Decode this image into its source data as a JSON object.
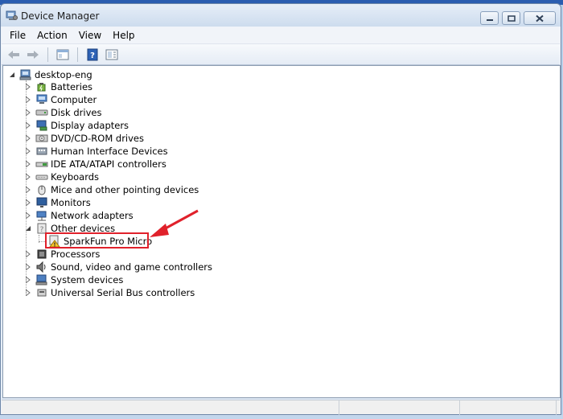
{
  "window": {
    "title": "Device Manager"
  },
  "menu": [
    "File",
    "Action",
    "View",
    "Help"
  ],
  "toolbar": [
    {
      "icon": "back-arrow-icon"
    },
    {
      "icon": "forward-arrow-icon"
    },
    {
      "icon": "console-tree-icon"
    },
    {
      "icon": "help-icon"
    },
    {
      "icon": "properties-icon"
    }
  ],
  "tree": {
    "root": "desktop-eng",
    "categories": [
      {
        "label": "Batteries",
        "icon": "battery-icon",
        "expanded": false
      },
      {
        "label": "Computer",
        "icon": "computer-icon",
        "expanded": false
      },
      {
        "label": "Disk drives",
        "icon": "disk-drive-icon",
        "expanded": false
      },
      {
        "label": "Display adapters",
        "icon": "display-adapter-icon",
        "expanded": false
      },
      {
        "label": "DVD/CD-ROM drives",
        "icon": "dvd-drive-icon",
        "expanded": false
      },
      {
        "label": "Human Interface Devices",
        "icon": "hid-icon",
        "expanded": false
      },
      {
        "label": "IDE ATA/ATAPI controllers",
        "icon": "ide-controller-icon",
        "expanded": false
      },
      {
        "label": "Keyboards",
        "icon": "keyboard-icon",
        "expanded": false
      },
      {
        "label": "Mice and other pointing devices",
        "icon": "mouse-icon",
        "expanded": false
      },
      {
        "label": "Monitors",
        "icon": "monitor-icon",
        "expanded": false
      },
      {
        "label": "Network adapters",
        "icon": "network-adapter-icon",
        "expanded": false
      },
      {
        "label": "Other devices",
        "icon": "other-devices-icon",
        "expanded": true,
        "children": [
          {
            "label": "SparkFun Pro Micro",
            "icon": "unknown-device-warning-icon"
          }
        ]
      },
      {
        "label": "Processors",
        "icon": "processor-icon",
        "expanded": false
      },
      {
        "label": "Sound, video and game controllers",
        "icon": "speaker-icon",
        "expanded": false
      },
      {
        "label": "System devices",
        "icon": "system-devices-icon",
        "expanded": false
      },
      {
        "label": "Universal Serial Bus controllers",
        "icon": "usb-icon",
        "expanded": false
      }
    ]
  },
  "annotation": {
    "color": "#e0212b",
    "target": "SparkFun Pro Micro"
  },
  "colors": {
    "titlebar": "#dbe6f3",
    "accent": "#2a5db0",
    "annotation": "#e0212b"
  }
}
